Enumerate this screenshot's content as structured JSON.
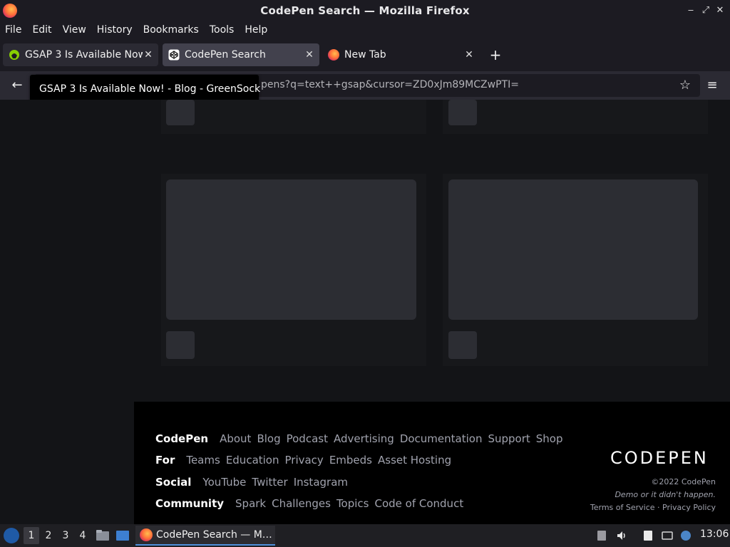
{
  "window": {
    "title": "CodePen Search — Mozilla Firefox"
  },
  "menubar": {
    "items": [
      "File",
      "Edit",
      "View",
      "History",
      "Bookmarks",
      "Tools",
      "Help"
    ]
  },
  "tabs": [
    {
      "label": "GSAP 3 Is Available Now! - Blog - GreenSock",
      "favicon": "greensock-icon",
      "active": false
    },
    {
      "label": "CodePen Search",
      "favicon": "codepen-icon",
      "active": true
    },
    {
      "label": "New Tab",
      "favicon": "firefox-icon",
      "active": false
    }
  ],
  "navbar": {
    "url": "pens?q=text++gsap&cursor=ZD0xJm89MCZwPTI="
  },
  "tooltip": {
    "text": "GSAP 3 Is Available Now! - Blog - GreenSock"
  },
  "footer": {
    "rows": [
      {
        "heading": "CodePen",
        "links": [
          "About",
          "Blog",
          "Podcast",
          "Advertising",
          "Documentation",
          "Support",
          "Shop"
        ]
      },
      {
        "heading": "For",
        "links": [
          "Teams",
          "Education",
          "Privacy",
          "Embeds",
          "Asset Hosting"
        ]
      },
      {
        "heading": "Social",
        "links": [
          "YouTube",
          "Twitter",
          "Instagram"
        ]
      },
      {
        "heading": "Community",
        "links": [
          "Spark",
          "Challenges",
          "Topics",
          "Code of Conduct"
        ]
      }
    ],
    "logo_text": "CODEPEN",
    "copyright": "©2022 CodePen",
    "tagline": "Demo or it didn't happen.",
    "terms": "Terms of Service",
    "separator": "·",
    "privacy": "Privacy Policy"
  },
  "taskbar": {
    "workspaces": [
      "1",
      "2",
      "3",
      "4"
    ],
    "active_task": "CodePen Search — M…",
    "clock": "13:06"
  }
}
